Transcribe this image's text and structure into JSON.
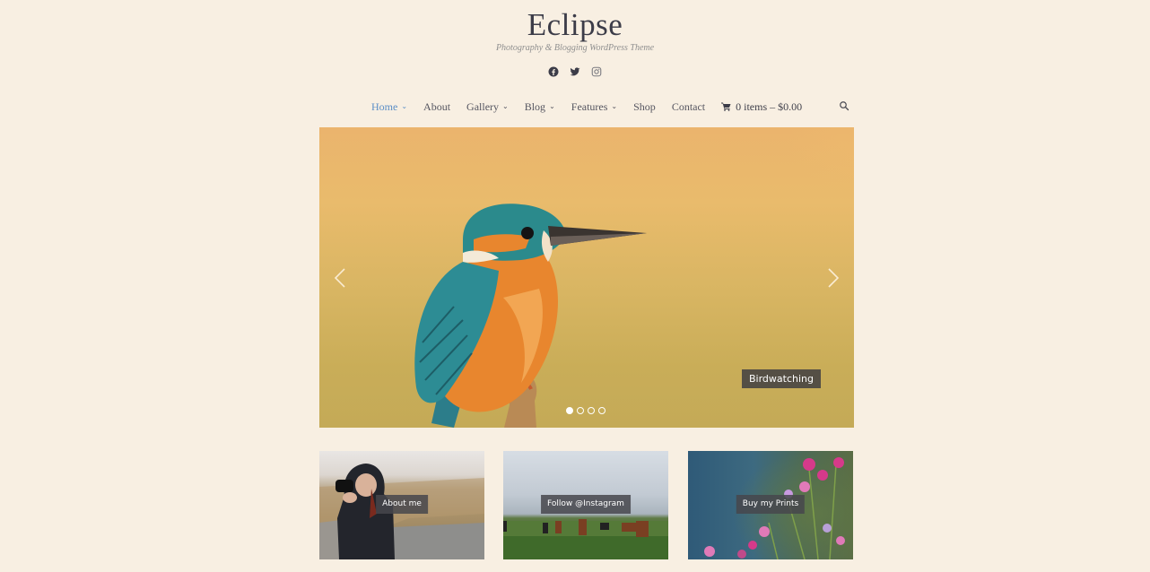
{
  "site": {
    "title": "Eclipse",
    "tagline": "Photography & Blogging WordPress Theme"
  },
  "social": [
    {
      "name": "facebook",
      "icon": "facebook-icon"
    },
    {
      "name": "twitter",
      "icon": "twitter-icon"
    },
    {
      "name": "instagram",
      "icon": "instagram-icon"
    }
  ],
  "nav": {
    "items": [
      {
        "label": "Home",
        "dropdown": true,
        "active": true
      },
      {
        "label": "About",
        "dropdown": false
      },
      {
        "label": "Gallery",
        "dropdown": true
      },
      {
        "label": "Blog",
        "dropdown": true
      },
      {
        "label": "Features",
        "dropdown": true
      },
      {
        "label": "Shop",
        "dropdown": false
      },
      {
        "label": "Contact",
        "dropdown": false
      }
    ],
    "cart_label": "0 items – $0.00",
    "chevron": "⌄",
    "active_color": "#5b8ec7"
  },
  "hero": {
    "caption": "Birdwatching",
    "slide_count": 4,
    "active_slide": 1
  },
  "tiles": [
    {
      "label": "About me"
    },
    {
      "label": "Follow @Instagram"
    },
    {
      "label": "Buy my Prints"
    }
  ]
}
